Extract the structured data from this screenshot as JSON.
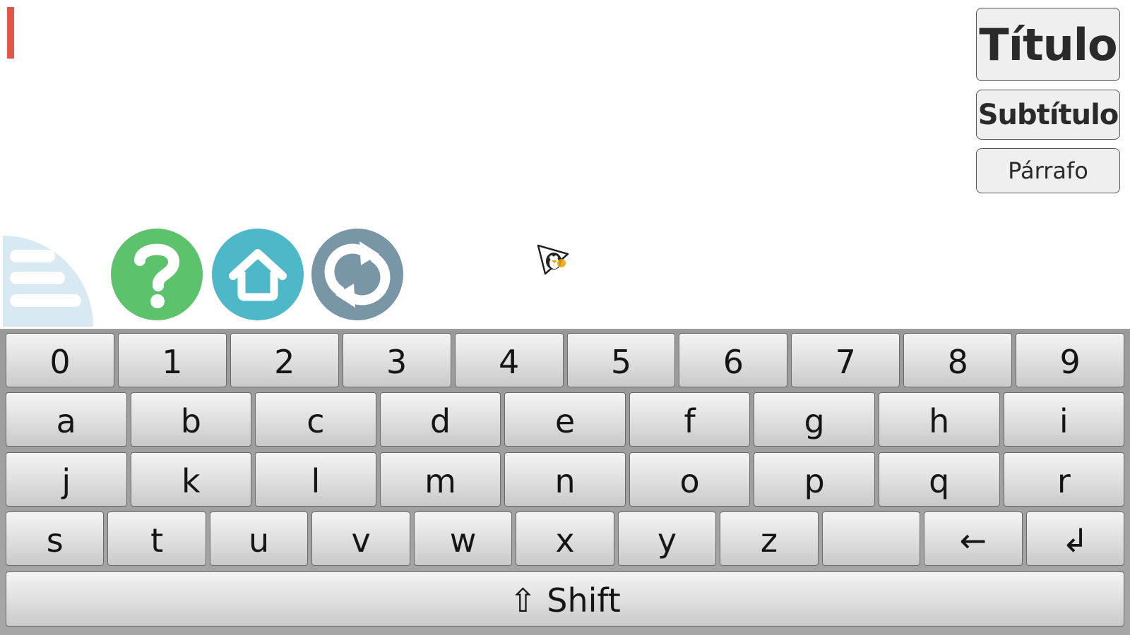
{
  "format_buttons": {
    "title": "Título",
    "subtitle": "Subtítulo",
    "paragraph": "Párrafo"
  },
  "icons": {
    "menu": "menu-icon",
    "help": "help-icon",
    "home": "home-icon",
    "refresh": "refresh-icon",
    "mouse_pointer": "tux-pointer-icon"
  },
  "colors": {
    "text_cursor": "#e0584a",
    "help": "#5cc26b",
    "home": "#4eb8c8",
    "refresh": "#7896a6",
    "menu_tab": "#d8e9f3"
  },
  "keyboard": {
    "rows": [
      [
        "0",
        "1",
        "2",
        "3",
        "4",
        "5",
        "6",
        "7",
        "8",
        "9"
      ],
      [
        "a",
        "b",
        "c",
        "d",
        "e",
        "f",
        "g",
        "h",
        "i"
      ],
      [
        "j",
        "k",
        "l",
        "m",
        "n",
        "o",
        "p",
        "q",
        "r"
      ],
      [
        "s",
        "t",
        "u",
        "v",
        "w",
        "x",
        "y",
        "z",
        " ",
        "←",
        "↲"
      ],
      [
        "⇧ Shift"
      ]
    ]
  }
}
